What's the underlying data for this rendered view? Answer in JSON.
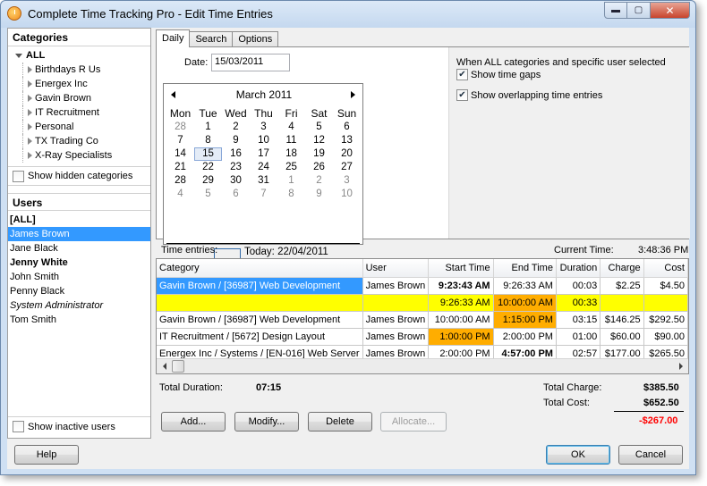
{
  "window": {
    "title": "Complete Time Tracking Pro - Edit Time Entries",
    "controls": {
      "minimize": "▬",
      "maximize": "▢",
      "close": "✕"
    }
  },
  "categories": {
    "header": "Categories",
    "root": "ALL",
    "items": [
      "Birthdays R Us",
      "Energex Inc",
      "Gavin Brown",
      "IT Recruitment",
      "Personal",
      "TX Trading Co",
      "X-Ray Specialists"
    ],
    "show_hidden_label": "Show hidden categories"
  },
  "users": {
    "header": "Users",
    "items": [
      {
        "label": "[ALL]",
        "style": "bold"
      },
      {
        "label": "James Brown",
        "style": "selected"
      },
      {
        "label": "Jane Black",
        "style": "normal"
      },
      {
        "label": "Jenny White",
        "style": "bold"
      },
      {
        "label": "John Smith",
        "style": "normal"
      },
      {
        "label": "Penny Black",
        "style": "normal"
      },
      {
        "label": "System Administrator",
        "style": "italic"
      },
      {
        "label": "Tom Smith",
        "style": "normal"
      }
    ],
    "show_inactive_label": "Show inactive users"
  },
  "tabs": [
    "Daily",
    "Search",
    "Options"
  ],
  "daily": {
    "date_label": "Date:",
    "date_value": "15/03/2011",
    "calendar": {
      "month": "March 2011",
      "weekdays": [
        "Mon",
        "Tue",
        "Wed",
        "Thu",
        "Fri",
        "Sat",
        "Sun"
      ],
      "weeks": [
        [
          "28",
          "1",
          "2",
          "3",
          "4",
          "5",
          "6"
        ],
        [
          "7",
          "8",
          "9",
          "10",
          "11",
          "12",
          "13"
        ],
        [
          "14",
          "15",
          "16",
          "17",
          "18",
          "19",
          "20"
        ],
        [
          "21",
          "22",
          "23",
          "24",
          "25",
          "26",
          "27"
        ],
        [
          "28",
          "29",
          "30",
          "31",
          "1",
          "2",
          "3"
        ],
        [
          "4",
          "5",
          "6",
          "7",
          "8",
          "9",
          "10"
        ]
      ],
      "selected_day": "15",
      "today_label": "Today: 22/04/2011"
    },
    "options": {
      "title": "When ALL categories and specific user selected",
      "show_time_gaps": "Show time gaps",
      "show_overlapping": "Show overlapping time entries"
    }
  },
  "entries": {
    "label": "Time entries:",
    "current_time_label": "Current Time:",
    "current_time": "3:48:36 PM",
    "columns": [
      "Category",
      "User",
      "Start Time",
      "End Time",
      "Duration",
      "Charge",
      "Cost"
    ],
    "rows": [
      [
        "Gavin Brown / [36987] Web Development",
        "James Brown",
        "9:23:43 AM",
        "9:26:33 AM",
        "00:03",
        "$2.25",
        "$4.50"
      ],
      [
        "",
        "",
        "9:26:33 AM",
        "10:00:00 AM",
        "00:33",
        "",
        ""
      ],
      [
        "Gavin Brown / [36987] Web Development",
        "James Brown",
        "10:00:00 AM",
        "1:15:00 PM",
        "03:15",
        "$146.25",
        "$292.50"
      ],
      [
        "IT Recruitment / [5672] Design Layout",
        "James Brown",
        "1:00:00 PM",
        "2:00:00 PM",
        "01:00",
        "$60.00",
        "$90.00"
      ],
      [
        "Energex Inc / Systems / [EN-016] Web Server",
        "James Brown",
        "2:00:00 PM",
        "4:57:00 PM",
        "02:57",
        "$177.00",
        "$265.50"
      ]
    ]
  },
  "totals": {
    "duration_label": "Total Duration:",
    "duration": "07:15",
    "charge_label": "Total Charge:",
    "charge": "$385.50",
    "cost_label": "Total Cost:",
    "cost": "$652.50",
    "diff": "-$267.00",
    "diff_color": "#ff0000"
  },
  "buttons": {
    "add": "Add...",
    "modify": "Modify...",
    "delete": "Delete",
    "allocate": "Allocate...",
    "help": "Help",
    "ok": "OK",
    "cancel": "Cancel"
  },
  "colors": {
    "selection": "#3399ff",
    "gap_row": "#ffff00",
    "overlap": "#ffad00"
  }
}
